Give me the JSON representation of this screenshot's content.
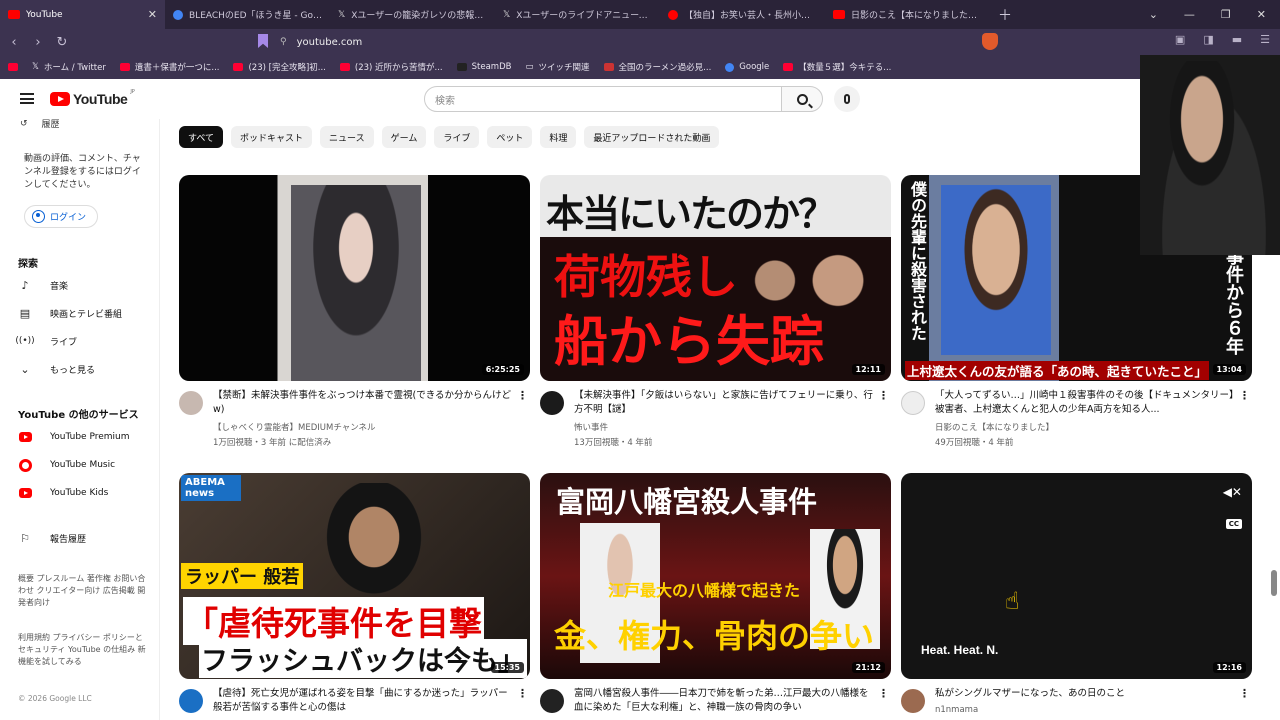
{
  "tabs": [
    {
      "title": "YouTube",
      "icon_color": "#ff0000",
      "active": true
    },
    {
      "title": "BLEACHのED「ほうき星 - Google 検索",
      "icon_color": "#4285f4"
    },
    {
      "title": "Xユーザーの籠染ガレソの悲報（審業投資",
      "icon_color": "#000000"
    },
    {
      "title": "Xユーザーのライブドアニュースさん「容疑",
      "icon_color": "#000000"
    },
    {
      "title": "【独自】お笑い芸人・長州小力さんを違法",
      "icon_color": "#ff0000"
    },
    {
      "title": "日影のこえ【本になりました】- YouTube",
      "icon_color": "#ff0000"
    }
  ],
  "url": "youtube.com",
  "bookmarks": [
    {
      "label": "ホーム / Twitter",
      "color": "#000000"
    },
    {
      "label": "遺書＋保書が一つに...",
      "color": "#ff0033"
    },
    {
      "label": "(23) [完全攻略]初...",
      "color": "#ff0033"
    },
    {
      "label": "(23) 近所から苦情が...",
      "color": "#ff0033"
    },
    {
      "label": "SteamDB",
      "color": "#222222"
    },
    {
      "label": "ツイッチ関連",
      "color": "#7c5cbf"
    },
    {
      "label": "全国のラーメン過必見...",
      "color": "#cc3333"
    },
    {
      "label": "Google",
      "color": "#4285f4"
    },
    {
      "label": "【数量５選】今キテる...",
      "color": "#ff0033"
    }
  ],
  "logo": {
    "word": "YouTube",
    "region": "JP"
  },
  "search": {
    "placeholder": "検索"
  },
  "sidebar": {
    "history": "履歴",
    "signin_text": "動画の評価、コメント、チャンネル登録をするにはログインしてください。",
    "signin_button": "ログイン",
    "explore_heading": "探索",
    "explore": [
      {
        "label": "音楽",
        "icon": "music-note-icon"
      },
      {
        "label": "映画とテレビ番組",
        "icon": "film-icon"
      },
      {
        "label": "ライブ",
        "icon": "live-icon"
      },
      {
        "label": "もっと見る",
        "icon": "chevron-down-icon"
      }
    ],
    "services_heading": "YouTube の他のサービス",
    "services": [
      {
        "label": "YouTube Premium"
      },
      {
        "label": "YouTube Music"
      },
      {
        "label": "YouTube Kids"
      }
    ],
    "report": "報告履歴",
    "footer1": "概要  プレスルーム  著作権  お問い合わせ  クリエイター向け  広告掲載  開発者向け",
    "footer2": "利用規約  プライバシー  ポリシーとセキュリティ  YouTube の仕組み  新機能を試してみる",
    "copyright": "© 2026 Google LLC"
  },
  "chips": [
    "すべて",
    "ポッドキャスト",
    "ニュース",
    "ゲーム",
    "ライブ",
    "ペット",
    "料理",
    "最近アップロードされた動画"
  ],
  "videos": [
    {
      "title": "【禁断】未解決事件事件をぶっつけ本番で霊視(できるか分からんけどw)",
      "channel": "【しゃべくり霊能者】MEDIUMチャンネル",
      "meta": "1万回視聴・3 年前 に配信済み",
      "duration": "6:25:25",
      "thumb_text": ""
    },
    {
      "title": "【未解決事件】「夕飯はいらない」と家族に告げてフェリーに乗り、行方不明【謎】",
      "channel": "怖い事件",
      "meta": "13万回視聴・4 年前",
      "duration": "12:11",
      "thumb_text": "本当にいたのか？",
      "thumb_text2": "荷物残し",
      "thumb_text3": "船から失踪"
    },
    {
      "title": "「大人ってずるい…」川崎中１殺害事件のその後【ドキュメンタリー】被害者、上村遼太くんと犯人の少年A両方を知る人...",
      "channel": "日影のこえ【本になりました】",
      "meta": "49万回視聴・4 年前",
      "duration": "13:04",
      "thumb_text": "僕の先輩に殺害された",
      "thumb_text2": "上村遼太くんの友が語る「あの時、起きていたこと」",
      "thumb_text3": "事件から６年"
    },
    {
      "title": "【虐待】死亡女児が運ばれる姿を目撃「曲にするか迷った」ラッパー般若が苦悩する事件と心の傷は",
      "channel": "",
      "meta": "",
      "duration": "15:35",
      "thumb_text": "ABEMA news",
      "thumb_text2": "ラッパー 般若",
      "thumb_text3": "「虐待死事件を目撃",
      "thumb_text4": "フラッシュバックは今も」"
    },
    {
      "title": "富岡八幡宮殺人事件――日本刀で姉を斬った弟…江戸最大の八幡様を血に染めた「巨大な利権」と、神職一族の骨肉の争い",
      "channel": "",
      "meta": "",
      "duration": "21:12",
      "thumb_text": "富岡八幡宮殺人事件",
      "thumb_text2": "江戸最大の八幡様で起きた",
      "thumb_text3": "金、権力、骨肉の争い"
    },
    {
      "title": "私がシングルマザーになった、あの日のこと",
      "channel": "n1nmama",
      "meta": "",
      "duration": "12:16",
      "thumb_text": "Heat. Heat. N."
    }
  ]
}
